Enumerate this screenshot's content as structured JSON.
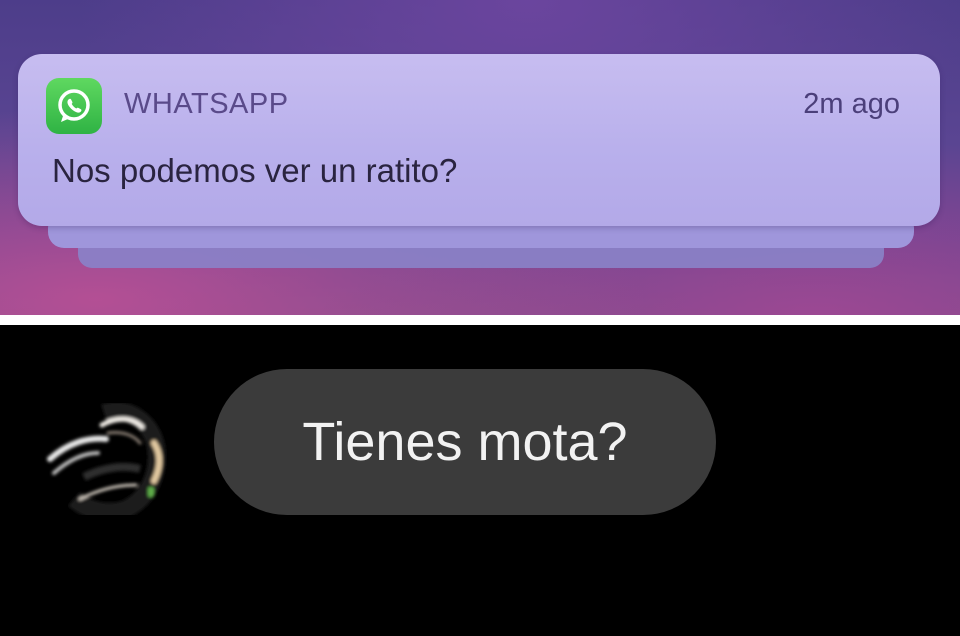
{
  "notification": {
    "app_icon": "whatsapp-icon",
    "app_name": "WHATSAPP",
    "time": "2m ago",
    "message": "Nos podemos ver un ratito?"
  },
  "chat": {
    "avatar": "blurred-avatar",
    "message": "Tienes mota?"
  },
  "colors": {
    "whatsapp_green": "#34c24a",
    "notification_bg": "#bdb3ee",
    "bubble_bg": "#3b3b3b"
  }
}
